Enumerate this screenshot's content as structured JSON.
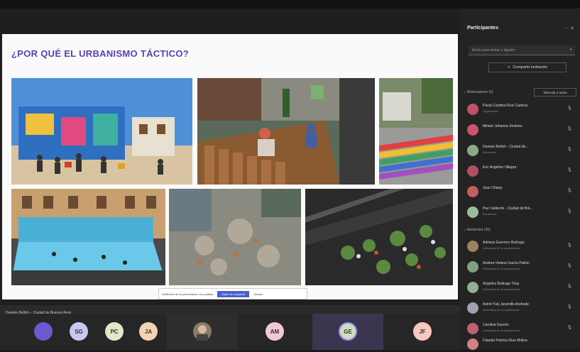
{
  "slide": {
    "title": "¿POR QUÉ EL URBANISMO TÁCTICO?",
    "share_bar": {
      "message": "Subtítulos de la presentación en pantalla",
      "primary": "Dejar de compartir",
      "secondary": "Ocultar"
    }
  },
  "presenter": {
    "name": "Daniela Bellich – Ciudad de Buenos Aires"
  },
  "gallery": [
    {
      "initials": "",
      "color": "#6a5acd"
    },
    {
      "initials": "SG",
      "color": "#c8c8f0"
    },
    {
      "initials": "PC",
      "color": "#dfe8c8"
    },
    {
      "initials": "JA",
      "color": "#f4d2b4"
    },
    {
      "initials": "",
      "color": "#888888"
    },
    {
      "initials": "AM",
      "color": "#f2c8d8"
    },
    {
      "initials": "GE",
      "color": "#cde0b8"
    },
    {
      "initials": "JF",
      "color": "#f6c8c0"
    }
  ],
  "panel": {
    "title": "Participantes",
    "invite_placeholder": "Envíe para invitar a alguien",
    "share_invite": "Compartir invitación",
    "section_presenters": "Moderadores (6)",
    "mute_all": "Silenciar a todos",
    "section_attendees": "Asistentes (35)",
    "presenters": [
      {
        "name": "Paula Carolina Ruiz Cadena",
        "role": "Organizador",
        "color": "#c0506a"
      },
      {
        "name": "Miriam Johanna Jiménez",
        "role": "",
        "color": "#d05070"
      },
      {
        "name": "Daniela Bellich - Ciudad de...",
        "role": "Moderador",
        "color": "#88aa88"
      },
      {
        "name": "Eric Angelino Villagra",
        "role": "",
        "color": "#b05060"
      },
      {
        "name": "Juan Chang",
        "role": "",
        "color": "#c06060"
      },
      {
        "name": "Paz Calderón - Ciudad de Bol...",
        "role": "Moderador",
        "color": "#99bb99"
      }
    ],
    "attendees": [
      {
        "name": "Adriana Guerrero Buitrago",
        "role": "Invitado(a) de la organización",
        "color": "#a08060"
      },
      {
        "name": "Andrea Viviana Garcia Pabón",
        "role": "Invitado(a) de la organización",
        "color": "#80a080"
      },
      {
        "name": "Angelica Buitrago Triay",
        "role": "Invitado(a) de la organización",
        "color": "#90b090"
      },
      {
        "name": "Astrid Yuly Jaramillo Andrade",
        "role": "Invitado(a) de la organización",
        "color": "#a0a0b0"
      },
      {
        "name": "Carolina Garzón",
        "role": "Invitado(a) de la organización",
        "color": "#c06070"
      },
      {
        "name": "Claudia Patricia Díaz Molina",
        "role": "",
        "color": "#d08080"
      }
    ]
  }
}
